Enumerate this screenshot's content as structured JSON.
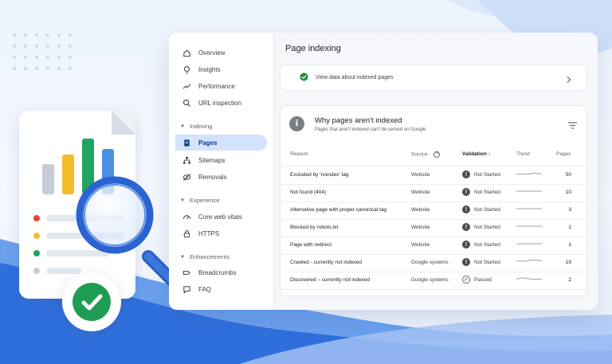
{
  "panel": {
    "page_title": "Page indexing",
    "link_card": {
      "text": "View data about indexed pages",
      "icon": "check-circle-icon",
      "chevron": "chevron-right-icon"
    },
    "table_card": {
      "title": "Why pages aren't indexed",
      "subtitle": "Pages that aren't indexed can't be served on Google",
      "columns": {
        "reason": "Reason",
        "source": "Source",
        "validation": "Validation",
        "trend": "Trend",
        "pages": "Pages"
      },
      "rows": [
        {
          "reason": "Excluded by ‘noindex’ tag",
          "source": "Website",
          "validation": "Not Started",
          "status": "bad",
          "pages": "50"
        },
        {
          "reason": "Not found (404)",
          "source": "Website",
          "validation": "Not Started",
          "status": "bad",
          "pages": "10"
        },
        {
          "reason": "Alternative page with proper canonical tag",
          "source": "Website",
          "validation": "Not Started",
          "status": "bad",
          "pages": "3"
        },
        {
          "reason": "Blocked by robots.txt",
          "source": "Website",
          "validation": "Not Started",
          "status": "bad",
          "pages": "2"
        },
        {
          "reason": "Page with redirect",
          "source": "Website",
          "validation": "Not Started",
          "status": "bad",
          "pages": "1"
        },
        {
          "reason": "Crawled - currently not indexed",
          "source": "Google systems",
          "validation": "Not Started",
          "status": "bad",
          "pages": "19"
        },
        {
          "reason": "Discovered – currently not indexed",
          "source": "Google systems",
          "validation": "Passed",
          "status": "good",
          "pages": "2"
        }
      ]
    }
  },
  "sidebar": {
    "items": [
      {
        "label": "Overview",
        "icon": "home-icon"
      },
      {
        "label": "Insights",
        "icon": "lightbulb-icon"
      },
      {
        "label": "Performance",
        "icon": "trending-up-icon"
      },
      {
        "label": "URL inspection",
        "icon": "search-icon"
      }
    ],
    "indexing": {
      "header": "Indexing",
      "items": [
        {
          "label": "Pages",
          "icon": "pages-icon",
          "active": true
        },
        {
          "label": "Sitemaps",
          "icon": "sitemap-icon"
        },
        {
          "label": "Removals",
          "icon": "removals-icon"
        }
      ]
    },
    "experience": {
      "header": "Experience",
      "items": [
        {
          "label": "Core web vitals",
          "icon": "speed-icon"
        },
        {
          "label": "HTTPS",
          "icon": "lock-icon"
        }
      ]
    },
    "enhancements": {
      "header": "Enhancements",
      "items": [
        {
          "label": "Breadcrumbs",
          "icon": "breadcrumbs-icon"
        },
        {
          "label": "FAQ",
          "icon": "faq-icon"
        }
      ]
    }
  },
  "colors": {
    "accent_blue": "#1a73e8",
    "active_nav_bg": "#d3e3fd",
    "check_green": "#1f9d55",
    "bar_gray": "#c5ccd8",
    "bar_yellow": "#f6bb2a",
    "bar_green": "#1fa463",
    "bar_blue": "#4a90e2"
  }
}
